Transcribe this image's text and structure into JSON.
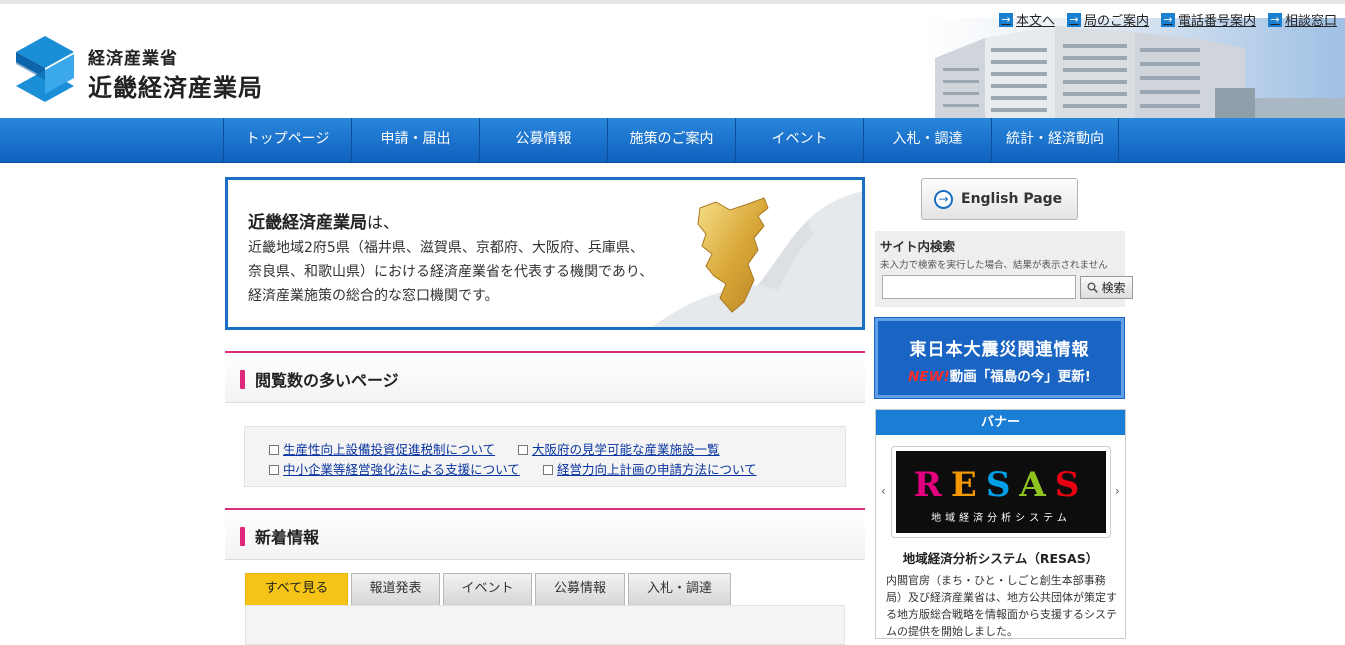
{
  "header": {
    "ministry": "経済産業省",
    "bureau": "近畿経済産業局",
    "util_links": [
      "本文へ",
      "局のご案内",
      "電話番号案内",
      "相談窓口"
    ]
  },
  "nav": [
    "トップページ",
    "申請・届出",
    "公募情報",
    "施策のご案内",
    "イベント",
    "入札・調達",
    "統計・経済動向"
  ],
  "intro": {
    "title_bold": "近畿経済産業局",
    "title_rest": "は、",
    "lines": [
      "近畿地域2府5県（福井県、滋賀県、京都府、大阪府、兵庫県、",
      "奈良県、和歌山県）における経済産業省を代表する機関であり、",
      "経済産業施策の総合的な窓口機関です。"
    ]
  },
  "popular": {
    "heading": "閲覧数の多いページ",
    "links": [
      "生産性向上設備投資促進税制について",
      "大阪府の見学可能な産業施設一覧",
      "中小企業等経営強化法による支援について",
      "経営力向上計画の申請方法について"
    ]
  },
  "news": {
    "heading": "新着情報",
    "tabs": [
      "すべて見る",
      "報道発表",
      "イベント",
      "公募情報",
      "入札・調達"
    ],
    "active_tab": 0
  },
  "sidebar": {
    "english_label": "English Page",
    "search_title": "サイト内検索",
    "search_note": "未入力で検索を実行した場合、結果が表示されません",
    "search_value": "",
    "search_button": "検索",
    "quake_title": "東日本大震災関連情報",
    "quake_new": "NEW!",
    "quake_sub": "動画「福島の今」更新!",
    "banner_head": "バナー",
    "resas_letters": [
      "R",
      "E",
      "S",
      "A",
      "S"
    ],
    "resas_sub": "地域経済分析システム",
    "banner_caption": "地域経済分析システム（RESAS）",
    "banner_desc": "内閣官房（まち・ひと・しごと創生本部事務局）及び経済産業省は、地方公共団体が策定する地方版総合戦略を情報面から支援するシステムの提供を開始しました。"
  },
  "colors": {
    "nav_blue": "#0f62be",
    "accent_pink": "#e0287a",
    "tab_active": "#f6c417",
    "link_blue": "#0a35a0"
  }
}
